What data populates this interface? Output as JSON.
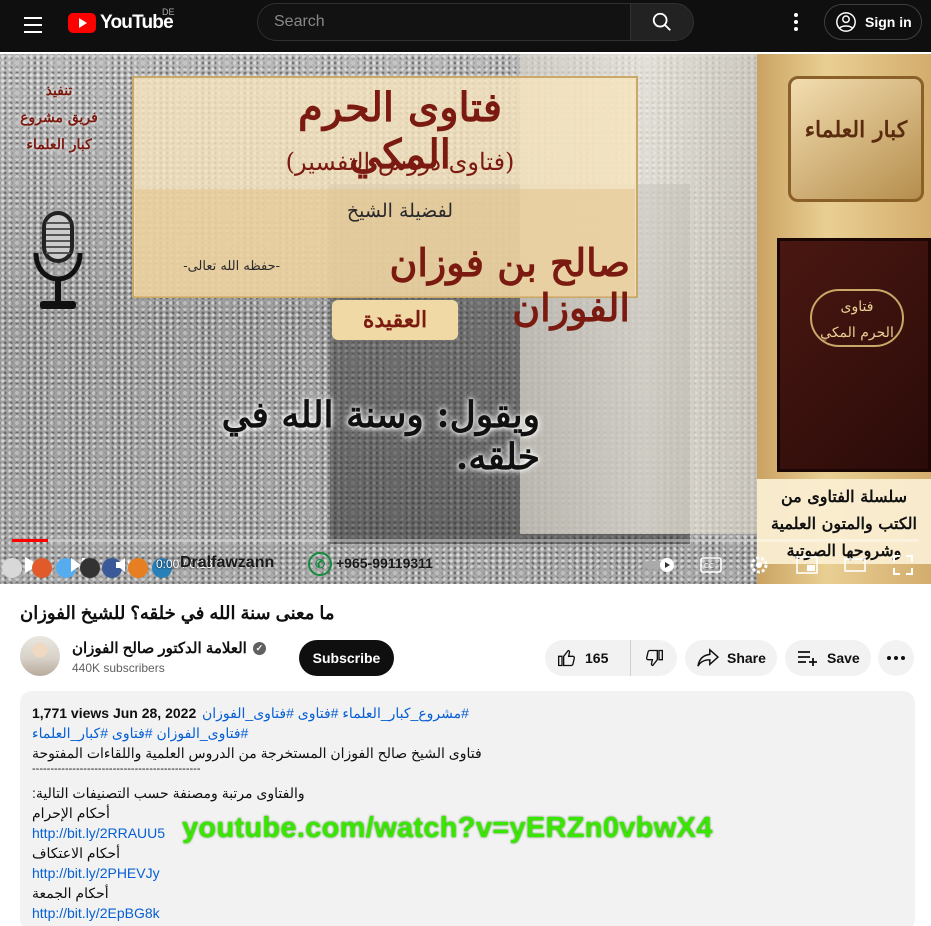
{
  "header": {
    "logo_text": "YouTube",
    "country_code": "DE",
    "search_placeholder": "Search",
    "signin_label": "Sign in"
  },
  "video": {
    "overlay": {
      "main_title": "فتاوى الحرم المكي",
      "subtitle": "(فتاوى دروس التفسير)",
      "sheikh_label": "لفضيلة الشيخ",
      "sheikh_name": "صالح بن فوزان الفوزان",
      "sheikh_suffix": "-حفظه الله تعالى-",
      "topic": "العقيدة",
      "quote": "ويقول: وسنة الله في خلقه.",
      "credits_line1": "تنفيذ",
      "credits_line2": "فريق مشروع",
      "credits_line3": "كبار العلماء",
      "badge_text": "كبار العلماء",
      "book_title_line1": "فتاوى",
      "book_title_line2": "الحرم المكي",
      "series_line1": "سلسلة الفتاوى من",
      "series_line2": "الكتب والمتون العلمية",
      "series_line3": "وشروحها الصوتية"
    },
    "controls": {
      "time_display": "0:00 / 0:13",
      "watermark": "Dralfawzann",
      "phone": "+965-99119311",
      "progress_fraction": 0.04
    }
  },
  "info": {
    "title": "ما معنى سنة الله في خلقه؟ للشيخ الفوزان",
    "channel_name": "العلامة الدكتور صالح الفوزان",
    "subscribers": "440K subscribers",
    "subscribe_label": "Subscribe",
    "like_count": "165",
    "share_label": "Share",
    "save_label": "Save"
  },
  "description": {
    "meta": "1,771 views  Jun 28, 2022",
    "tags_line1": "#مشروع_كبار_العلماء #فتاوى #فتاوى_الفوزان",
    "tags_line2": "#فتاوى_الفوزان #فتاوى #كبار_العلماء",
    "line1": "فتاوى الشيخ صالح الفوزان المستخرجة من الدروس العلمية واللقاءات المفتوحة",
    "separator": "----------------------------------------------",
    "line2": "والفتاوى مرتبة ومصنفة حسب التصنيفات التالية:",
    "cat1": "أحكام الإحرام",
    "link1": "http://bit.ly/2RRAUU5",
    "cat2": "أحكام الاعتكاف",
    "link2": "http://bit.ly/2PHEVJy",
    "cat3": "أحكام الجمعة",
    "link3": "http://bit.ly/2EpBG8k",
    "url_overlay": "youtube.com/watch?v=yERZn0vbwX4"
  },
  "icons": {
    "menu": "menu-icon",
    "search": "search-icon",
    "more": "more-vert-icon",
    "account": "account-icon",
    "like": "thumb-up-icon",
    "dislike": "thumb-down-icon",
    "share": "share-icon",
    "save": "playlist-add-icon"
  },
  "colors": {
    "accent_red": "#ff0000",
    "link_blue": "#065fd4",
    "overlay_green": "#39e600"
  }
}
